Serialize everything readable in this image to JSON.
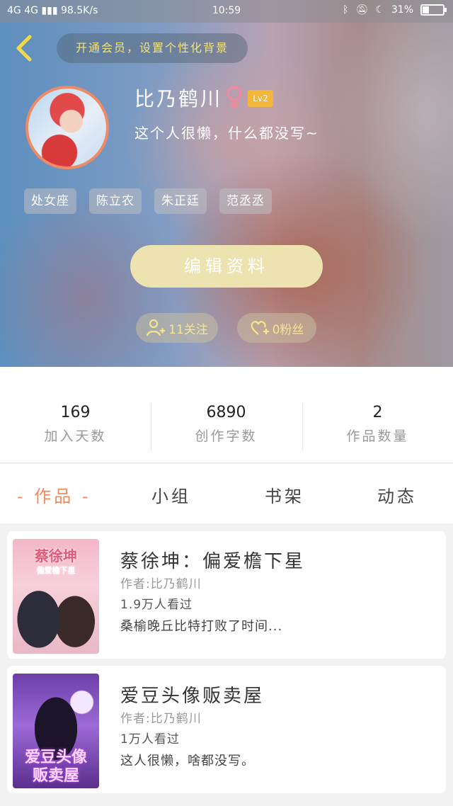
{
  "status_bar": {
    "network": "4G 4G",
    "speed": "98.5K/s",
    "time": "10:59",
    "battery": "31%",
    "battery_fraction": 0.31
  },
  "header": {
    "vip_banner": "开通会员，设置个性化背景",
    "username": "比乃鹤川",
    "gender": "♀",
    "level": "Lv2",
    "bio": "这个人很懒，什么都没写~",
    "tags": [
      "处女座",
      "陈立农",
      "朱正廷",
      "范丞丞"
    ],
    "edit_button": "编辑资料",
    "follow_label": "11关注",
    "fans_label": "0粉丝"
  },
  "stats": [
    {
      "value": "169",
      "label": "加入天数"
    },
    {
      "value": "6890",
      "label": "创作字数"
    },
    {
      "value": "2",
      "label": "作品数量"
    }
  ],
  "tabs": [
    "- 作品 -",
    "小组",
    "书架",
    "动态"
  ],
  "works": [
    {
      "cover_title": "蔡徐坤",
      "cover_sub": "偏爱檐下星",
      "title": "蔡徐坤：偏爱檐下星",
      "author": "作者:比乃鹤川",
      "views": "1.9万人看过",
      "desc": "桑榆晚丘比特打败了时间..."
    },
    {
      "cover_title": "爱豆头像",
      "cover_sub": "贩卖屋",
      "title": "爱豆头像贩卖屋",
      "author": "作者:比乃鹤川",
      "views": "1万人看过",
      "desc": "这人很懒，啥都没写。"
    }
  ],
  "colors": {
    "accent": "#f08a5d",
    "level_badge": "#f3b53a",
    "vip_text": "#f3e37a",
    "edit_button": "#ece3b0"
  }
}
